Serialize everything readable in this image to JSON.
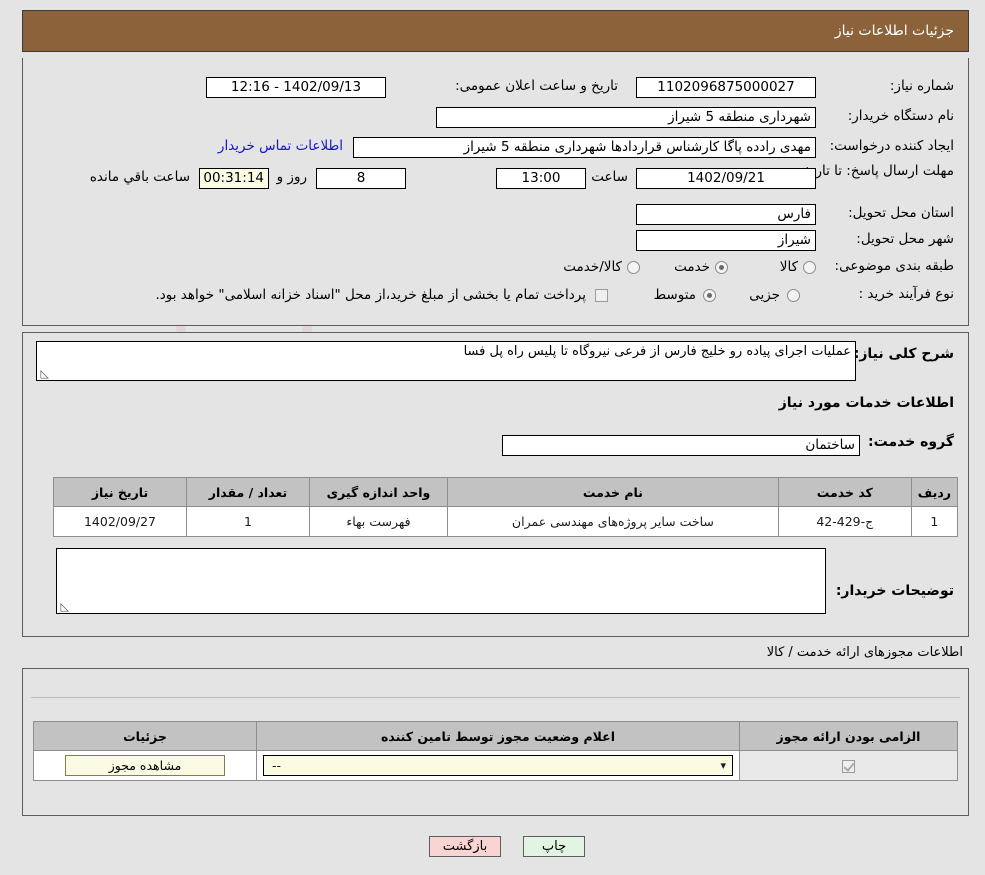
{
  "header": {
    "title": "جزئیات اطلاعات نیاز"
  },
  "form": {
    "need_number_label": "شماره نیاز:",
    "need_number_value": "1102096875000027",
    "announce_label": "تاریخ و ساعت اعلان عمومی:",
    "announce_value": "1402/09/13 - 12:16",
    "buyer_org_label": "نام دستگاه خریدار:",
    "buyer_org_value": "شهرداری منطقه 5 شیراز",
    "creator_label": "ایجاد کننده درخواست:",
    "creator_value": "مهدی رادده پاگا کارشناس قراردادها شهرداری منطقه 5 شیراز",
    "contact_link": "اطلاعات تماس خریدار",
    "deadline_label": "مهلت ارسال پاسخ: تا تاریخ:",
    "deadline_date": "1402/09/21",
    "hour_label": "ساعت",
    "hour_value": "13:00",
    "days_value": "8",
    "days_label": "روز و",
    "remaining_value": "00:31:14",
    "remaining_label": "ساعت باقي مانده",
    "province_label": "استان محل تحویل:",
    "province_value": "فارس",
    "city_label": "شهر محل تحویل:",
    "city_value": "شیراز",
    "category_label": "طبقه بندی موضوعی:",
    "category_options": [
      {
        "label": "کالا",
        "selected": false
      },
      {
        "label": "خدمت",
        "selected": true
      },
      {
        "label": "کالا/خدمت",
        "selected": false
      }
    ],
    "process_label": "نوع فرآیند خرید :",
    "process_options": [
      {
        "label": "جزیی",
        "selected": false
      },
      {
        "label": "متوسط",
        "selected": true
      }
    ],
    "treasury_checked": false,
    "treasury_note": "پرداخت تمام یا بخشی از مبلغ خرید،از محل \"اسناد خزانه اسلامی\" خواهد بود."
  },
  "middle": {
    "general_desc_label": "شرح کلی نیاز:",
    "general_desc_value": "عملیات اجرای پیاده رو خلیج فارس از فرعی نیروگاه تا پلیس راه پل فسا",
    "services_info_title": "اطلاعات خدمات مورد نیاز",
    "service_group_label": "گروه خدمت:",
    "service_group_value": "ساختمان",
    "table": {
      "headers": [
        "ردیف",
        "کد خدمت",
        "نام خدمت",
        "واحد اندازه گیری",
        "تعداد / مقدار",
        "تاریخ نیاز"
      ],
      "rows": [
        [
          "1",
          "ج-429-42",
          "ساخت سایر پروژه‌های مهندسی عمران",
          "فهرست بهاء",
          "1",
          "1402/09/27"
        ]
      ]
    },
    "buyer_notes_label": "توضیحات خریدار:",
    "buyer_notes_value": ""
  },
  "licenses": {
    "caption": "اطلاعات مجوزهای ارائه خدمت / کالا",
    "table": {
      "headers": [
        "الزامی بودن ارائه مجوز",
        "اعلام وضعیت مجوز توسط تامین کننده",
        "جزئیات"
      ],
      "rows": [
        {
          "required_checked": true,
          "status_value": "--",
          "detail_button": "مشاهده مجوز"
        }
      ]
    }
  },
  "footer": {
    "print_label": "چاپ",
    "back_label": "بازگشت"
  },
  "watermark": {
    "text": "AnaTender.net"
  },
  "colors": {
    "header_bg": "#8b6239",
    "link": "#1414cf",
    "print_bg": "#e2f5e2",
    "back_bg": "#fad3d3",
    "highlight_field": "#fbfbe4",
    "table_header_bg": "#c2c2c2"
  }
}
